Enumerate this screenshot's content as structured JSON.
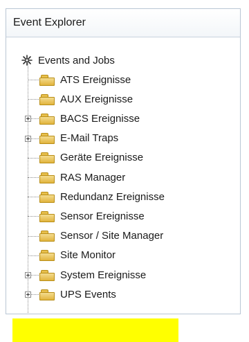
{
  "panel": {
    "title": "Event Explorer",
    "root": {
      "label": "Events and Jobs",
      "icon": "events-jobs-icon"
    },
    "items": [
      {
        "label": "ATS Ereignisse",
        "expandable": false,
        "highlighted": false,
        "icon": "folder-icon"
      },
      {
        "label": "AUX Ereignisse",
        "expandable": false,
        "highlighted": false,
        "icon": "folder-icon"
      },
      {
        "label": "BACS Ereignisse",
        "expandable": true,
        "highlighted": false,
        "icon": "folder-icon"
      },
      {
        "label": "E-Mail Traps",
        "expandable": true,
        "highlighted": false,
        "icon": "folder-icon"
      },
      {
        "label": "Geräte Ereignisse",
        "expandable": false,
        "highlighted": false,
        "icon": "folder-icon"
      },
      {
        "label": "RAS Manager",
        "expandable": false,
        "highlighted": false,
        "icon": "folder-icon"
      },
      {
        "label": "Redundanz Ereignisse",
        "expandable": false,
        "highlighted": false,
        "icon": "folder-icon"
      },
      {
        "label": "Sensor Ereignisse",
        "expandable": false,
        "highlighted": false,
        "icon": "folder-icon"
      },
      {
        "label": "Sensor / Site Manager",
        "expandable": false,
        "highlighted": false,
        "icon": "folder-icon"
      },
      {
        "label": "Site Monitor",
        "expandable": false,
        "highlighted": false,
        "icon": "folder-icon"
      },
      {
        "label": "System Ereignisse",
        "expandable": true,
        "highlighted": false,
        "icon": "folder-icon"
      },
      {
        "label": "UPS Events",
        "expandable": true,
        "highlighted": true,
        "icon": "folder-icon"
      }
    ]
  },
  "colors": {
    "highlight": "#ffff00",
    "folder": "#e7bf4c",
    "border": "#b9c6d4"
  }
}
